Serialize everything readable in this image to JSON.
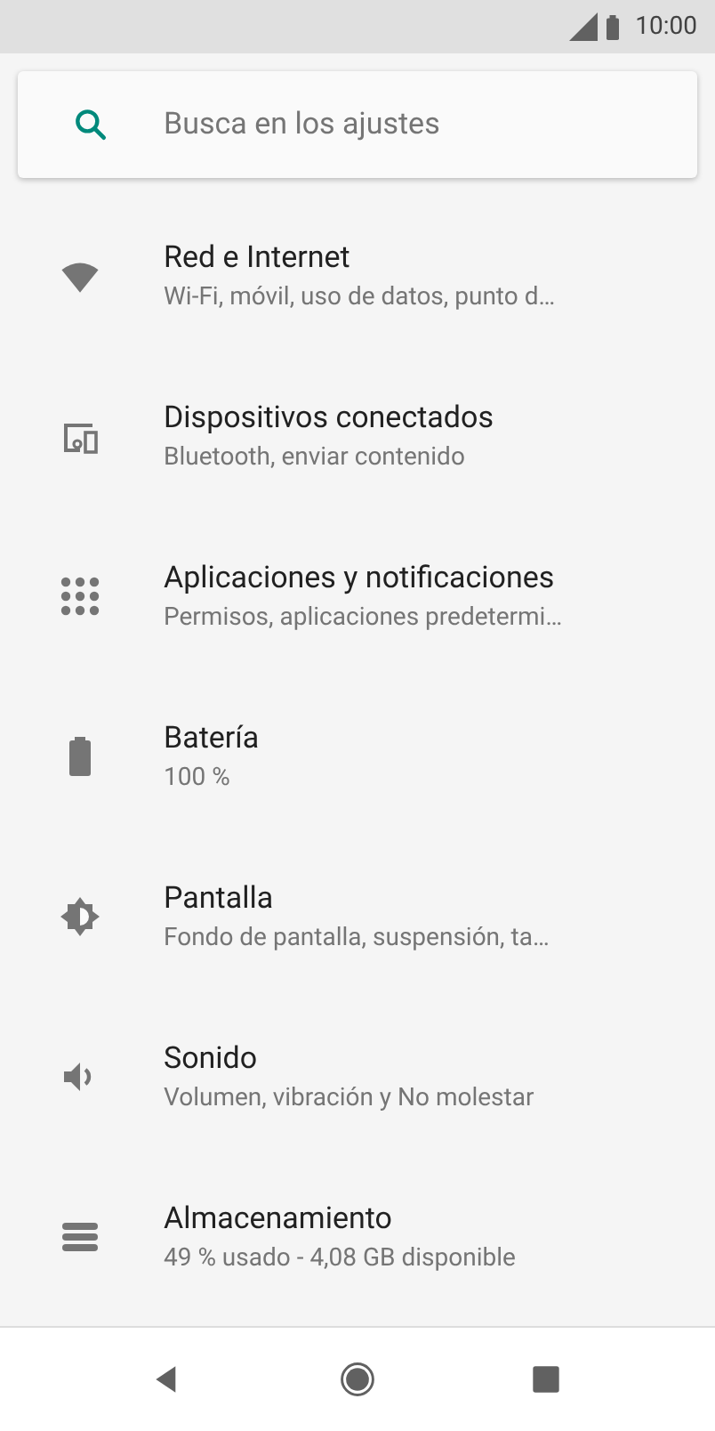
{
  "status_bar": {
    "time": "10:00"
  },
  "search": {
    "placeholder": "Busca en los ajustes"
  },
  "settings": [
    {
      "kind": "network",
      "title": "Red e Internet",
      "summary": "Wi-Fi, móvil, uso de datos, punto d…"
    },
    {
      "kind": "devices",
      "title": "Dispositivos conectados",
      "summary": "Bluetooth, enviar contenido"
    },
    {
      "kind": "apps",
      "title": "Aplicaciones y notificaciones",
      "summary": "Permisos, aplicaciones predetermi…"
    },
    {
      "kind": "battery",
      "title": "Batería",
      "summary": "100 %"
    },
    {
      "kind": "display",
      "title": "Pantalla",
      "summary": "Fondo de pantalla, suspensión, ta…"
    },
    {
      "kind": "sound",
      "title": "Sonido",
      "summary": "Volumen, vibración y No molestar"
    },
    {
      "kind": "storage",
      "title": "Almacenamiento",
      "summary": "49 % usado - 4,08 GB disponible"
    }
  ],
  "nav_bar": [
    {
      "kind": "back"
    },
    {
      "kind": "home"
    },
    {
      "kind": "recents"
    }
  ]
}
